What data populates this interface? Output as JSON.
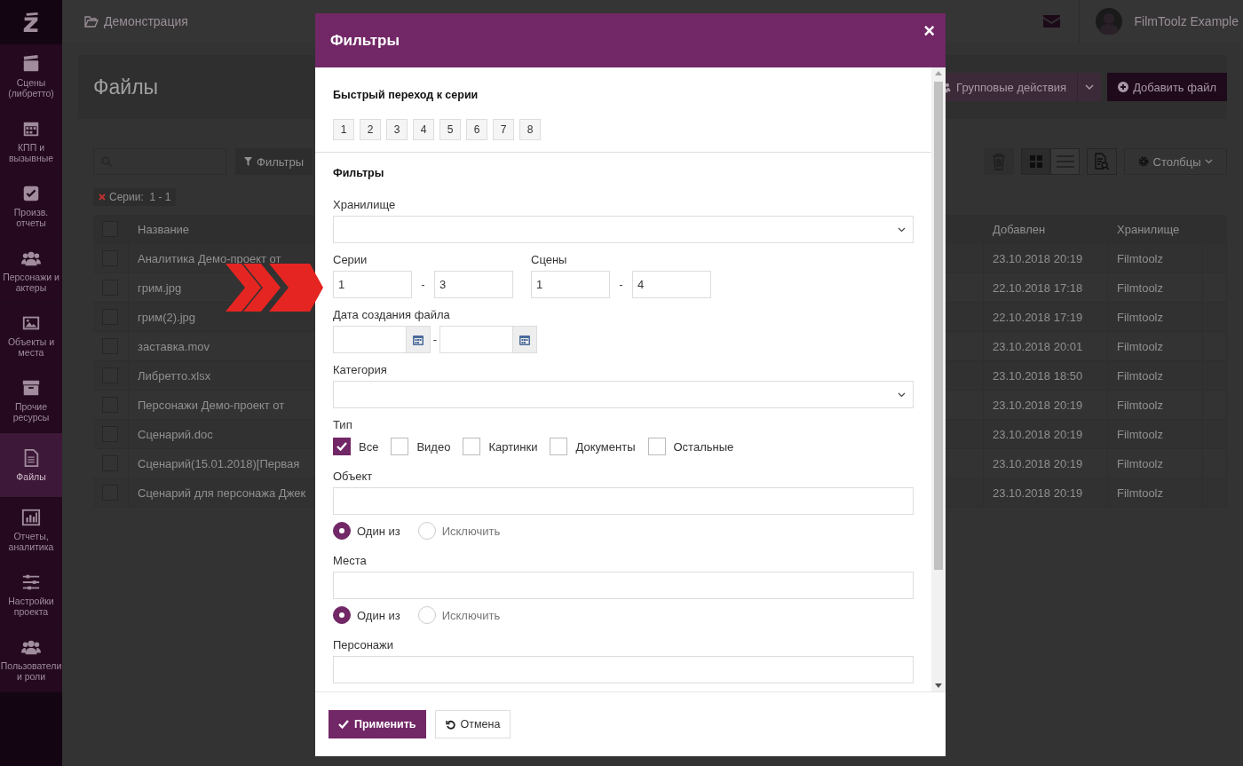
{
  "sidebar": {
    "items": [
      {
        "label": "Сцены (либретто)",
        "selected": false
      },
      {
        "label": "КПП и вызывные",
        "selected": false
      },
      {
        "label": "Произв. отчеты",
        "selected": false
      },
      {
        "label": "Персонажи и актеры",
        "selected": false
      },
      {
        "label": "Объекты и места",
        "selected": false
      },
      {
        "label": "Прочие ресурсы",
        "selected": false
      },
      {
        "label": "Файлы",
        "selected": true
      },
      {
        "label": "Отчеты, аналитика",
        "selected": false
      },
      {
        "label": "Настройки проекта",
        "selected": false
      },
      {
        "label": "Пользователи и роли",
        "selected": false
      }
    ]
  },
  "topbar": {
    "breadcrumb": "Демонстрация",
    "user": "FilmToolz Example"
  },
  "page": {
    "title": "Файлы",
    "group_actions": "Групповые действия",
    "add_button": "Добавить файл",
    "filters_button": "Фильтры",
    "columns_button": "Столбцы",
    "view_buttons": [
      {
        "kind": "grid",
        "selected": true
      },
      {
        "kind": "list",
        "selected": false
      }
    ],
    "tags": [
      "Серии:  1 - 1"
    ]
  },
  "table": {
    "select_all_checked": false,
    "columns": [
      "Название",
      "Добавлен",
      "Хранилище"
    ],
    "rows": [
      {
        "checked": false,
        "name": "Аналитика Демо-проект от",
        "added": "23.10.2018 20:19",
        "storage": "Filmtoolz"
      },
      {
        "checked": false,
        "name": "грим.jpg",
        "added": "22.10.2018 17:18",
        "storage": "Filmtoolz"
      },
      {
        "checked": false,
        "name": "грим(2).jpg",
        "added": "22.10.2018 17:19",
        "storage": "Filmtoolz"
      },
      {
        "checked": false,
        "name": "заставка.mov",
        "added": "23.10.2018 20:01",
        "storage": "Filmtoolz"
      },
      {
        "checked": false,
        "name": "Либретто.xlsx",
        "added": "23.10.2018 18:50",
        "storage": "Filmtoolz"
      },
      {
        "checked": false,
        "name": "Персонажи Демо-проект от",
        "added": "23.10.2018 20:19",
        "storage": "Filmtoolz"
      },
      {
        "checked": false,
        "name": "Сценарий.doc",
        "added": "23.10.2018 20:19",
        "storage": "Filmtoolz"
      },
      {
        "checked": false,
        "name": "Сценарий(15.01.2018)[Первая",
        "added": "23.10.2018 20:19",
        "storage": "Filmtoolz"
      },
      {
        "checked": false,
        "name": "Сценарий для персонажа Джек",
        "added": "23.10.2018 20:19",
        "storage": "Filmtoolz"
      }
    ]
  },
  "modal": {
    "title": "Фильтры",
    "close": "×",
    "quick_jump": {
      "title": "Быстрый переход к серии",
      "episodes": [
        "1",
        "2",
        "3",
        "4",
        "5",
        "6",
        "7",
        "8"
      ]
    },
    "section_title": "Фильтры",
    "storage": {
      "label": "Хранилище"
    },
    "series": {
      "label": "Серии",
      "from": "1",
      "separator": "-",
      "to": "3"
    },
    "scenes": {
      "label": "Сцены",
      "from": "1",
      "separator": "-",
      "to": "4"
    },
    "date": {
      "label": "Дата создания файла",
      "separator": "-"
    },
    "category": {
      "label": "Категория"
    },
    "type": {
      "label": "Тип",
      "options": [
        {
          "label": "Все",
          "checked": true
        },
        {
          "label": "Видео",
          "checked": false
        },
        {
          "label": "Картинки",
          "checked": false
        },
        {
          "label": "Документы",
          "checked": false
        },
        {
          "label": "Остальные",
          "checked": false
        }
      ]
    },
    "object": {
      "label": "Объект",
      "modes": [
        {
          "label": "Один из",
          "selected": true
        },
        {
          "label": "Исключить",
          "selected": false
        }
      ]
    },
    "places": {
      "label": "Места",
      "modes": [
        {
          "label": "Один из",
          "selected": true
        },
        {
          "label": "Исключить",
          "selected": false
        }
      ]
    },
    "characters": {
      "label": "Персонажи"
    },
    "apply": "Применить",
    "cancel": "Отмена"
  }
}
